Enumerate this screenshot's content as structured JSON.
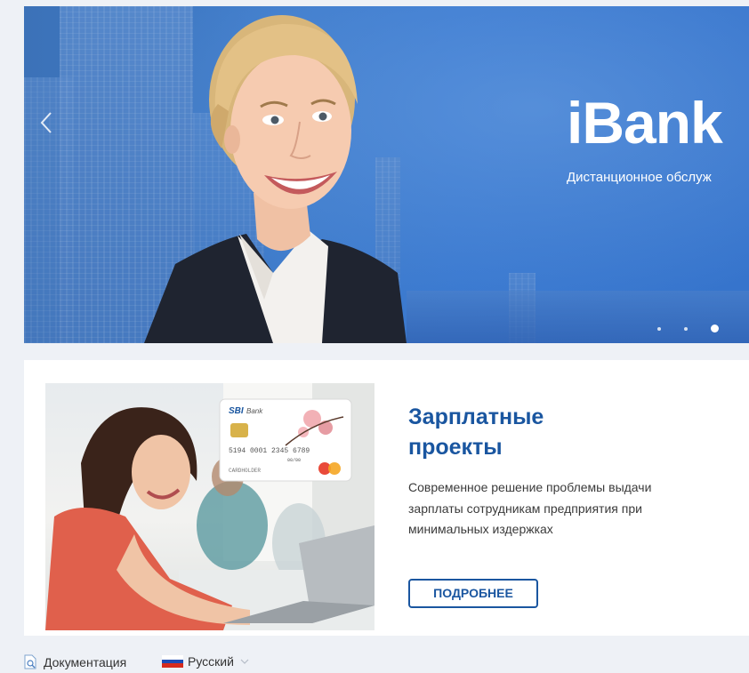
{
  "hero": {
    "title": "iBank",
    "subtitle": "Дистанционное обслуж",
    "dots_count": 3,
    "active_dot": 3
  },
  "promo": {
    "title": "Зарплатные проекты",
    "text": "Современное решение проблемы выдачи зарплаты сотрудникам предприятия при минимальных издержках",
    "button_label": "ПОДРОБНЕЕ",
    "card": {
      "bank_name": "SBI",
      "bank_word": "Bank",
      "number": "5194 0001 2345 6789",
      "valid": "00/00",
      "holder": "CARDHOLDER"
    }
  },
  "footer": {
    "docs_label": "Документация",
    "language": "Русский"
  },
  "colors": {
    "brand_blue": "#1a56a0",
    "hero_blue": "#3a79d0",
    "background": "#eef1f6"
  },
  "icons": {
    "slider_prev": "chevron-left-icon",
    "docs": "document-search-icon",
    "language_dropdown": "chevron-down-icon",
    "flag": "russia-flag-icon"
  }
}
